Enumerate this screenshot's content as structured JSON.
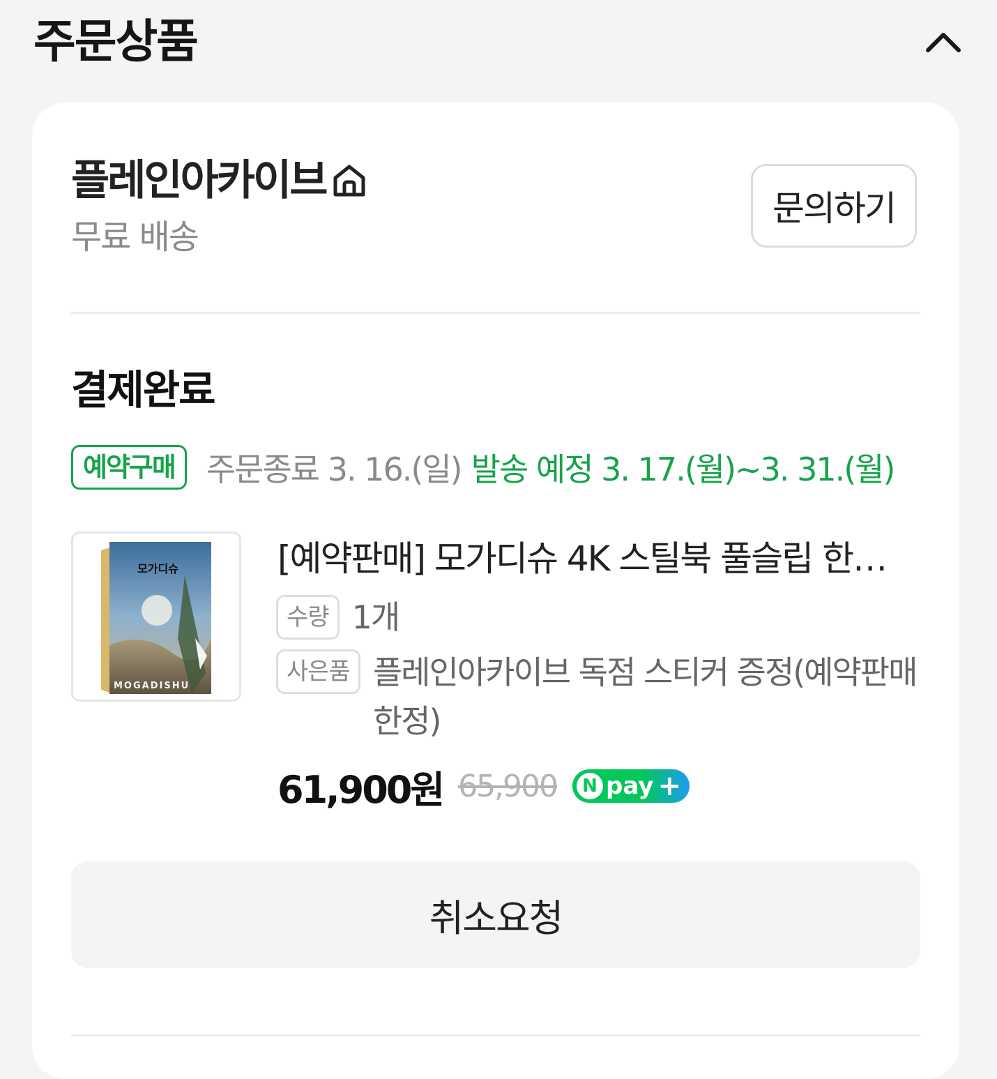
{
  "section": {
    "title": "주문상품"
  },
  "seller": {
    "name": "플레인아카이브",
    "shipping": "무료 배송",
    "inquiry_label": "문의하기"
  },
  "order": {
    "status": "결제완료",
    "badge": "예약구매",
    "order_end": "주문종료 3. 16.(일)",
    "ship_schedule": "발송 예정 3. 17.(월)~3. 31.(월)"
  },
  "product": {
    "title": "[예약판매] 모가디슈 4K 스틸북 풀슬립 한정…",
    "thumb_title": "모가디슈",
    "thumb_subtitle": "MOGADISHU",
    "qty_label": "수량",
    "qty_value": "1개",
    "gift_label": "사은품",
    "gift_value": "플레인아카이브 독점 스티커 증정(예약판매 한정)",
    "price": "61,900원",
    "original_price": "65,900",
    "npay_n": "N",
    "npay_text": "pay",
    "npay_plus": "+"
  },
  "actions": {
    "cancel_label": "취소요청"
  },
  "colors": {
    "accent_green": "#17a34a",
    "npay_green": "#03c75a",
    "npay_blue": "#1e9cf0"
  }
}
